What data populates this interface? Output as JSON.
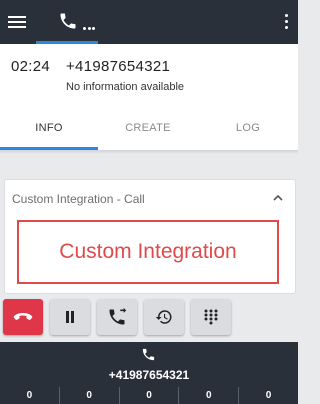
{
  "header": {
    "menu_icon": "hamburger-icon",
    "active_tab_icon": "phone-icon",
    "more_icon": "kebab-icon",
    "accent": "#2b86e6"
  },
  "call": {
    "time": "02:24",
    "number": "+41987654321",
    "info": "No information available"
  },
  "tabs": [
    {
      "label": "INFO",
      "active": true
    },
    {
      "label": "CREATE",
      "active": false
    },
    {
      "label": "LOG",
      "active": false
    }
  ],
  "integration": {
    "title": "Custom Integration - Call",
    "content": "Custom Integration",
    "accent": "#e04a4a"
  },
  "controls": [
    {
      "icon": "hangup-icon",
      "color": "#e0364a"
    },
    {
      "icon": "pause-icon"
    },
    {
      "icon": "transfer-icon"
    },
    {
      "icon": "history-icon"
    },
    {
      "icon": "dialpad-icon"
    }
  ],
  "footer": {
    "icon": "phone-icon",
    "number": "+41987654321",
    "stats": [
      "0",
      "0",
      "0",
      "0",
      "0"
    ]
  }
}
